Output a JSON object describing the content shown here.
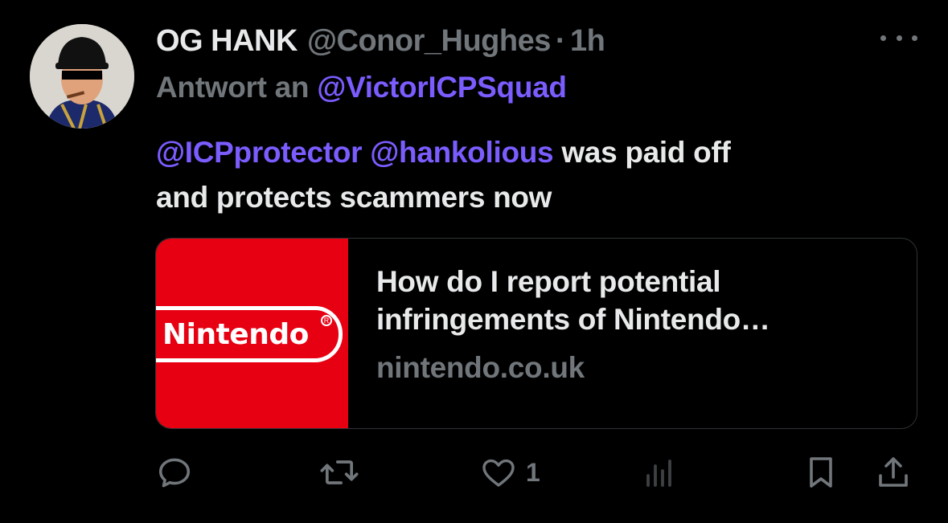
{
  "tweet": {
    "display_name": "OG HANK",
    "handle": "@Conor_Hughes",
    "separator": "·",
    "time": "1h",
    "reply_prefix": "Antwort an",
    "reply_to": "@VictorICPSquad",
    "text_mention_1": "@ICPprotector",
    "text_mention_2": "@hankolious",
    "text_line_1_rest": "was paid off",
    "text_line_2": "and protects scammers now"
  },
  "card": {
    "logo_text": "Nintendo",
    "title": "How do I report potential infringements of Nintendo…",
    "domain": "nintendo.co.uk"
  },
  "actions": {
    "like_count": "1"
  },
  "colors": {
    "background": "#000000",
    "text": "#e7e9ea",
    "muted": "#71767b",
    "mention": "#7b5cff",
    "nintendo_red": "#e60012",
    "border": "#2f3336"
  },
  "icons": [
    "avatar",
    "more-icon",
    "reply-icon",
    "retweet-icon",
    "like-icon",
    "views-icon",
    "bookmark-icon",
    "share-icon"
  ]
}
